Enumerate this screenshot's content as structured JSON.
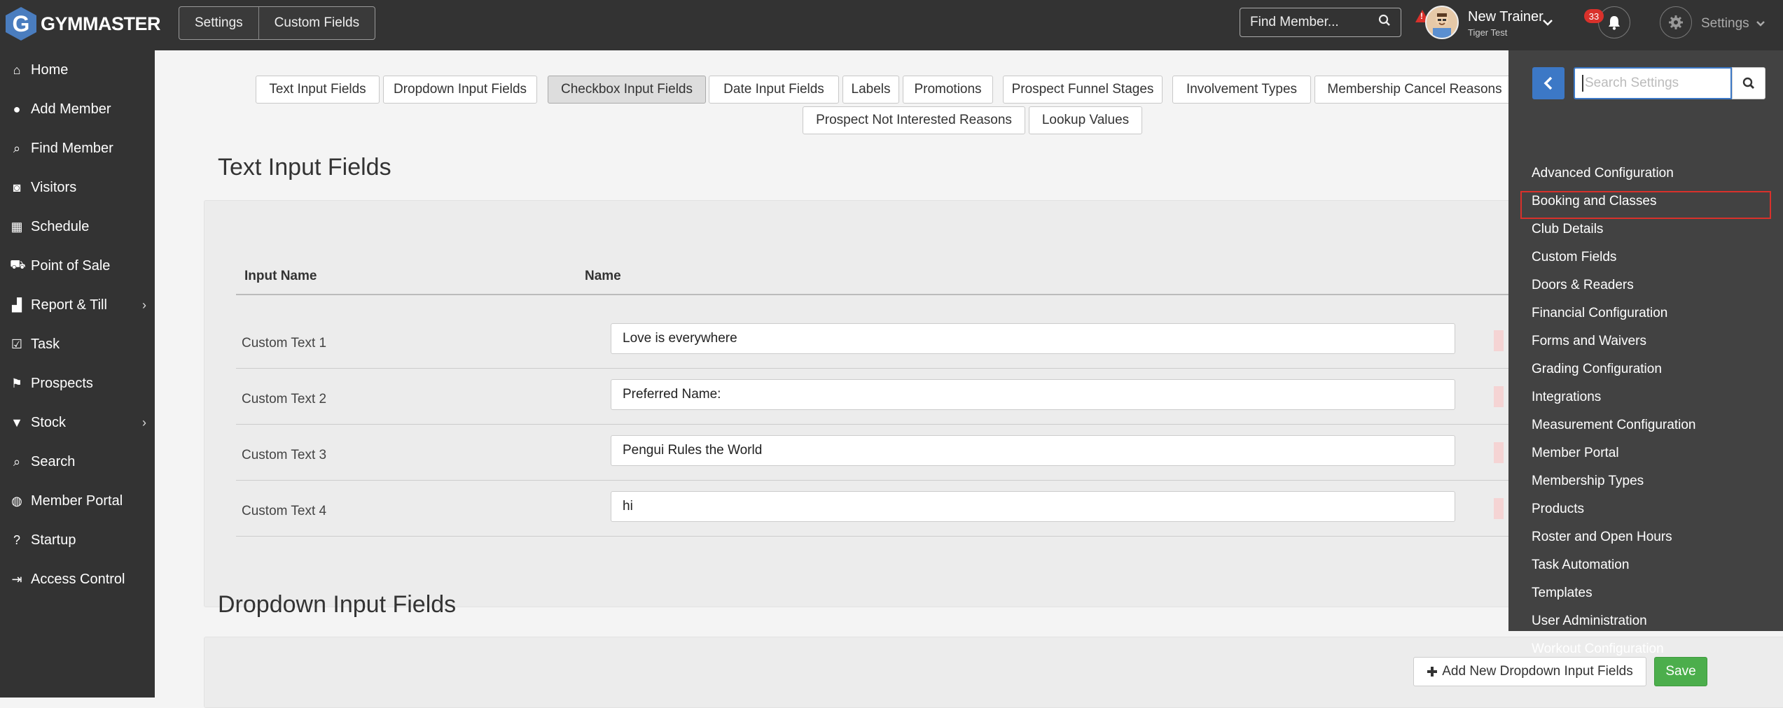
{
  "brand": {
    "logo_letter": "G",
    "name": "GYMMASTER"
  },
  "breadcrumb": [
    "Settings",
    "Custom Fields"
  ],
  "topbar": {
    "find_member_placeholder": "Find Member...",
    "alert_mark": "!",
    "user_name": "New Trainer",
    "user_sub": "Tiger Test",
    "notification_count": "33",
    "settings_label": "Settings"
  },
  "sidebar": {
    "items": [
      {
        "label": "Home",
        "icon": "home-icon",
        "glyph": "⌂"
      },
      {
        "label": "Add Member",
        "icon": "user-icon",
        "glyph": "●"
      },
      {
        "label": "Find Member",
        "icon": "search-icon",
        "glyph": "⌕"
      },
      {
        "label": "Visitors",
        "icon": "badge-icon",
        "glyph": "◙"
      },
      {
        "label": "Schedule",
        "icon": "calendar-icon",
        "glyph": "▦"
      },
      {
        "label": "Point of Sale",
        "icon": "cart-icon",
        "glyph": "⛟"
      },
      {
        "label": "Report & Till",
        "icon": "chart-icon",
        "glyph": "▟",
        "arrow": "›"
      },
      {
        "label": "Task",
        "icon": "checkbox-icon",
        "glyph": "☑"
      },
      {
        "label": "Prospects",
        "icon": "flag-icon",
        "glyph": "⚑"
      },
      {
        "label": "Stock",
        "icon": "shirt-icon",
        "glyph": "▼",
        "arrow": "›"
      },
      {
        "label": "Search",
        "icon": "search-icon",
        "glyph": "⌕"
      },
      {
        "label": "Member Portal",
        "icon": "globe-icon",
        "glyph": "◍"
      },
      {
        "label": "Startup",
        "icon": "question-icon",
        "glyph": "?"
      },
      {
        "label": "Access Control",
        "icon": "sign-in-icon",
        "glyph": "⇥"
      }
    ]
  },
  "tabs": [
    "Text Input Fields",
    "Dropdown Input Fields",
    "Checkbox Input Fields",
    "Date Input Fields",
    "Labels",
    "Promotions",
    "Prospect Funnel Stages",
    "Involvement Types",
    "Membership Cancel Reasons",
    "Prospect Not Interested Reasons",
    "Lookup Values"
  ],
  "active_tab": "Checkbox Input Fields",
  "text_section": {
    "title": "Text Input Fields",
    "col_input_name": "Input Name",
    "col_name": "Name",
    "rows": [
      {
        "input_name": "Custom Text 1",
        "value": "Love is everywhere"
      },
      {
        "input_name": "Custom Text 2",
        "value": "Preferred Name:"
      },
      {
        "input_name": "Custom Text 3",
        "value": "Pengui Rules the World"
      },
      {
        "input_name": "Custom Text 4",
        "value": "hi"
      }
    ]
  },
  "dropdown_section": {
    "title": "Dropdown Input Fields",
    "add_button": "Add New Dropdown Input Fields",
    "save_button": "Save"
  },
  "settings_menu": {
    "search_placeholder": "Search Settings",
    "selected": "Custom Fields",
    "items": [
      "Advanced Configuration",
      "Booking and Classes",
      "Club Details",
      "Custom Fields",
      "Doors & Readers",
      "Financial Configuration",
      "Forms and Waivers",
      "Grading Configuration",
      "Integrations",
      "Measurement Configuration",
      "Member Portal",
      "Membership Types",
      "Products",
      "Roster and Open Hours",
      "Task Automation",
      "Templates",
      "User Administration",
      "Workout Configuration"
    ]
  },
  "colors": {
    "accent": "#3c78c6",
    "save": "#4cae4c",
    "alert": "#d9312b",
    "chrome": "#333333"
  }
}
